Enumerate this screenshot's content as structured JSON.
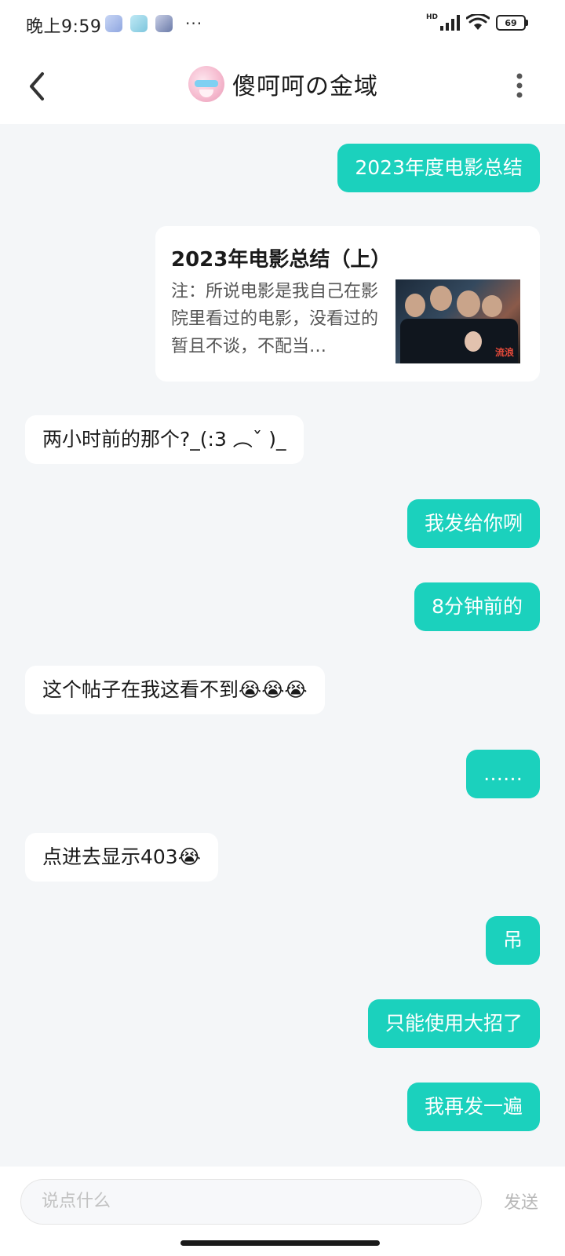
{
  "status_bar": {
    "time": "晚上9:59",
    "more": "···",
    "network": "HD",
    "battery": "69"
  },
  "header": {
    "title": "傻呵呵の金域"
  },
  "messages": [
    {
      "side": "me",
      "text": "2023年度电影总结"
    },
    {
      "side": "me",
      "type": "card",
      "title": "2023年电影总结（上）",
      "description": "注：所说电影是我自己在影院里看过的电影，没看过的暂且不谈，不配当…",
      "thumb_logo": "流浪"
    },
    {
      "side": "them",
      "text": "两小时前的那个?_(:3 ︵ˇ )_"
    },
    {
      "side": "me",
      "text": "我发给你咧"
    },
    {
      "side": "me",
      "text": "8分钟前的"
    },
    {
      "side": "them",
      "text": "这个帖子在我这看不到😭😭😭"
    },
    {
      "side": "me",
      "text": "……"
    },
    {
      "side": "them",
      "text": "点进去显示403😭"
    },
    {
      "side": "me",
      "text": "吊"
    },
    {
      "side": "me",
      "text": "只能使用大招了"
    },
    {
      "side": "me",
      "text": "我再发一遍"
    }
  ],
  "input": {
    "placeholder": "说点什么",
    "send_label": "发送"
  },
  "colors": {
    "accent": "#1bd1bd",
    "background": "#f4f6f8"
  }
}
